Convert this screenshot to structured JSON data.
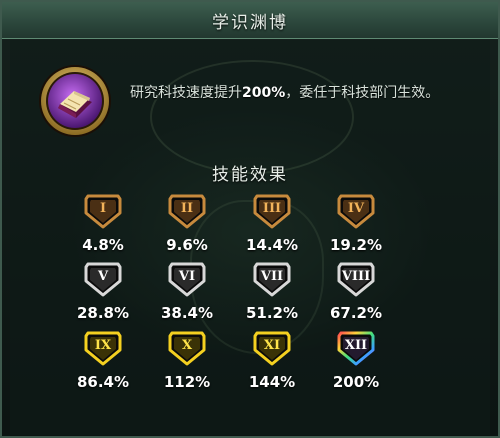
{
  "window": {
    "title": "学识渊博"
  },
  "skill": {
    "icon": "purple-book-icon",
    "description_before": "研究科技速度提升",
    "description_value": "200%",
    "description_after": "，委任于科技部门生效。"
  },
  "effects": {
    "title": "技能效果",
    "levels": [
      {
        "numeral": "I",
        "value": "4.8%",
        "tier": "bronze"
      },
      {
        "numeral": "II",
        "value": "9.6%",
        "tier": "bronze"
      },
      {
        "numeral": "III",
        "value": "14.4%",
        "tier": "bronze"
      },
      {
        "numeral": "IV",
        "value": "19.2%",
        "tier": "bronze"
      },
      {
        "numeral": "V",
        "value": "28.8%",
        "tier": "silver"
      },
      {
        "numeral": "VI",
        "value": "38.4%",
        "tier": "silver"
      },
      {
        "numeral": "VII",
        "value": "51.2%",
        "tier": "silver"
      },
      {
        "numeral": "VIII",
        "value": "67.2%",
        "tier": "silver"
      },
      {
        "numeral": "IX",
        "value": "86.4%",
        "tier": "gold"
      },
      {
        "numeral": "X",
        "value": "112%",
        "tier": "gold"
      },
      {
        "numeral": "XI",
        "value": "144%",
        "tier": "gold"
      },
      {
        "numeral": "XII",
        "value": "200%",
        "tier": "rainbow"
      }
    ]
  },
  "colors": {
    "bronze_fill": "#4a2f14",
    "bronze_border": "#c78a3d",
    "bronze_text": "#f2b35a",
    "silver_fill": "#2a2a2a",
    "silver_border": "#d8d8d8",
    "silver_text": "#ffffff",
    "gold_fill": "#3a3206",
    "gold_border": "#f4d020",
    "gold_text": "#ffe44a",
    "rainbow_fill": "#231a2e",
    "rainbow_text": "#ffffff"
  }
}
